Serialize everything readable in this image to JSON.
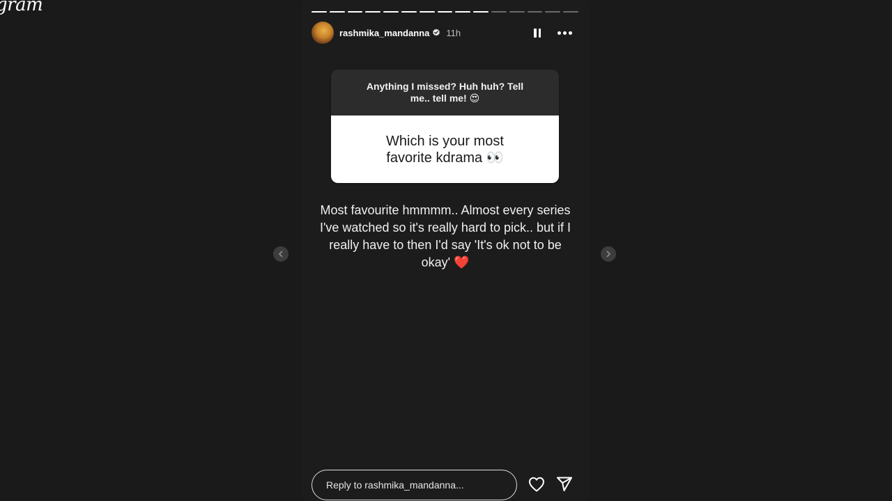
{
  "brand": {
    "text": "gram"
  },
  "story": {
    "progress": {
      "total_segments": 15,
      "completed_segments": 10
    },
    "user": {
      "username": "rashmika_mandanna",
      "verified": true,
      "time": "11h"
    },
    "header_icons": [
      "pause-icon",
      "more-options-icon"
    ],
    "question": {
      "prompt": "Anything I missed? Huh huh? Tell me.. tell me! 😍",
      "answer_text": "Which is your most favorite kdrama 👀"
    },
    "reply_text": "Most favourite hmmmm.. Almost every series I've watched so it's really hard to pick.. but if I really have to then I'd say 'It's ok not to be okay' ❤️",
    "reply_input": {
      "placeholder": "Reply to rashmika_mandanna..."
    },
    "actions": [
      "heart-icon",
      "send-icon"
    ],
    "nav": [
      "previous-story-icon",
      "next-story-icon"
    ]
  },
  "colors": {
    "page_bg": "#1a1a1a",
    "story_bg": "#1c1c1c",
    "question_top_bg": "#2c2c2c",
    "question_bottom_bg": "#ffffff",
    "text": "#ffffff"
  }
}
